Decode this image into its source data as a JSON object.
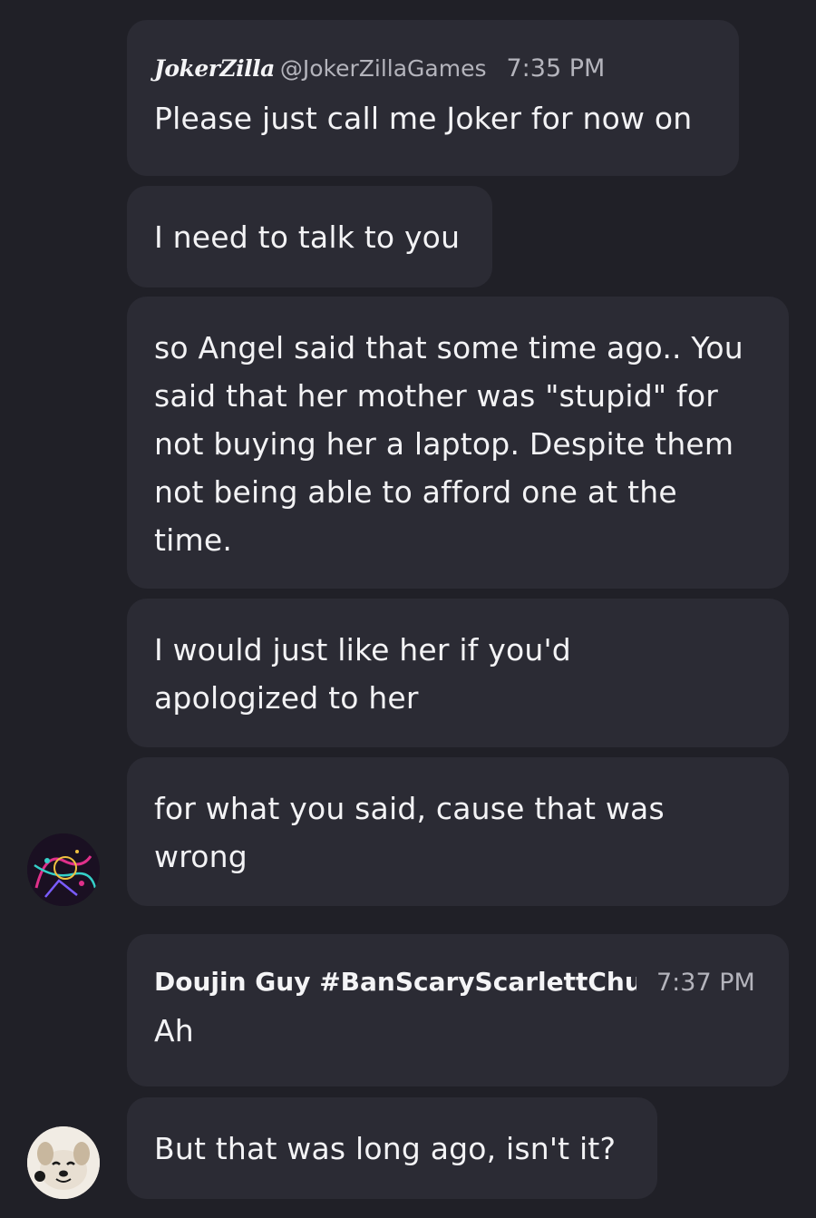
{
  "messages": [
    {
      "display_name": "JokerZilla",
      "handle": "@JokerZillaGames",
      "time": "7:35 PM",
      "text": "Please just call me Joker for now on"
    },
    {
      "text": "I need to talk to you"
    },
    {
      "text": "so Angel said that some time ago.. You said that her mother was \"stupid\" for not buying her a laptop. Despite them not being able to afford one at the time."
    },
    {
      "text": "I would just like her if you'd apologized to her"
    },
    {
      "text": "for what you said, cause that was wrong"
    },
    {
      "display_name": "Doujin Guy #BanScaryScarlettChu",
      "time": "7:37 PM",
      "text": "Ah"
    },
    {
      "text": "But that was long ago, isn't it?"
    }
  ],
  "avatars": {
    "joker": {
      "icon": "neon-art-avatar-icon",
      "colors": [
        "#1a1022",
        "#e0308a",
        "#35d0c8",
        "#f0c040",
        "#7a5cff"
      ]
    },
    "doujin": {
      "icon": "dog-avatar-icon",
      "colors": [
        "#f1ece4",
        "#c8b79e",
        "#1a1a1a"
      ]
    }
  }
}
